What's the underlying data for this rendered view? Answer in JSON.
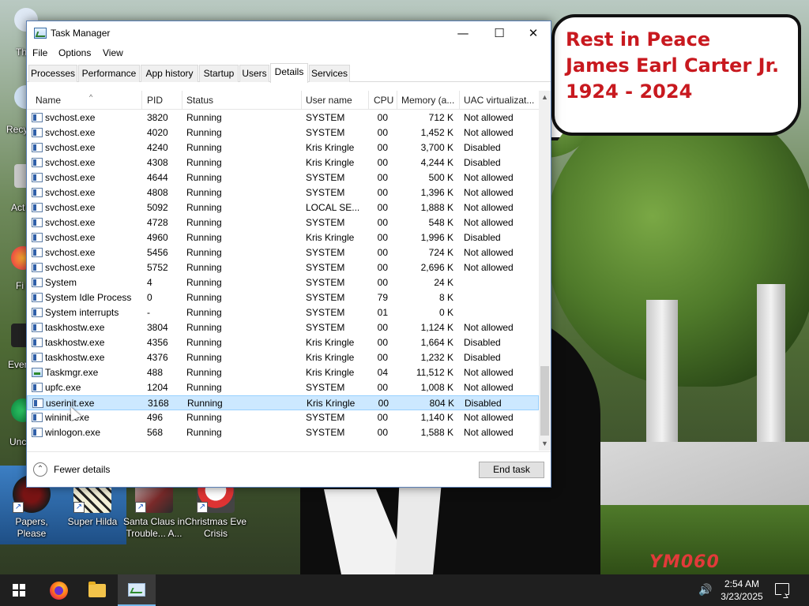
{
  "wallpaper": {
    "bubble_lines": [
      "Rest in Peace",
      "James Earl Carter Jr.",
      "1924 - 2024"
    ],
    "watermark": "YM060 ",
    "bubble_text_color": "#c8191f"
  },
  "desktop_icons": [
    {
      "name": "papers-please",
      "label": "Papers, Please",
      "icon": "game-icon"
    },
    {
      "name": "super-hilda",
      "label": "Super Hilda",
      "icon": "game-icon"
    },
    {
      "name": "santa-claus",
      "label": "Santa Claus in Trouble... A...",
      "icon": "game-icon"
    },
    {
      "name": "christmas-eve",
      "label": "Christmas Eve Crisis",
      "icon": "game-icon"
    }
  ],
  "partial_labels": {
    "th": "Th",
    "recy": "Recy",
    "act": "Act",
    "fi": "Fi",
    "ever": "Ever",
    "unc": "Unc"
  },
  "window": {
    "title": "Task Manager",
    "minimize": "—",
    "maximize": "☐",
    "close": "✕"
  },
  "menu": [
    "File",
    "Options",
    "View"
  ],
  "tabs": [
    "Processes",
    "Performance",
    "App history",
    "Startup",
    "Users",
    "Details",
    "Services"
  ],
  "active_tab": "Details",
  "columns": {
    "name": "Name",
    "pid": "PID",
    "status": "Status",
    "user": "User name",
    "cpu": "CPU",
    "memory": "Memory (a...",
    "uac": "UAC virtualizat..."
  },
  "sort_arrow": "^",
  "rows": [
    {
      "name": "svchost.exe",
      "pid": "3820",
      "status": "Running",
      "user": "SYSTEM",
      "cpu": "00",
      "mem": "712 K",
      "uac": "Not allowed"
    },
    {
      "name": "svchost.exe",
      "pid": "4020",
      "status": "Running",
      "user": "SYSTEM",
      "cpu": "00",
      "mem": "1,452 K",
      "uac": "Not allowed"
    },
    {
      "name": "svchost.exe",
      "pid": "4240",
      "status": "Running",
      "user": "Kris Kringle",
      "cpu": "00",
      "mem": "3,700 K",
      "uac": "Disabled"
    },
    {
      "name": "svchost.exe",
      "pid": "4308",
      "status": "Running",
      "user": "Kris Kringle",
      "cpu": "00",
      "mem": "4,244 K",
      "uac": "Disabled"
    },
    {
      "name": "svchost.exe",
      "pid": "4644",
      "status": "Running",
      "user": "SYSTEM",
      "cpu": "00",
      "mem": "500 K",
      "uac": "Not allowed"
    },
    {
      "name": "svchost.exe",
      "pid": "4808",
      "status": "Running",
      "user": "SYSTEM",
      "cpu": "00",
      "mem": "1,396 K",
      "uac": "Not allowed"
    },
    {
      "name": "svchost.exe",
      "pid": "5092",
      "status": "Running",
      "user": "LOCAL SE...",
      "cpu": "00",
      "mem": "1,888 K",
      "uac": "Not allowed"
    },
    {
      "name": "svchost.exe",
      "pid": "4728",
      "status": "Running",
      "user": "SYSTEM",
      "cpu": "00",
      "mem": "548 K",
      "uac": "Not allowed"
    },
    {
      "name": "svchost.exe",
      "pid": "4960",
      "status": "Running",
      "user": "Kris Kringle",
      "cpu": "00",
      "mem": "1,996 K",
      "uac": "Disabled"
    },
    {
      "name": "svchost.exe",
      "pid": "5456",
      "status": "Running",
      "user": "SYSTEM",
      "cpu": "00",
      "mem": "724 K",
      "uac": "Not allowed"
    },
    {
      "name": "svchost.exe",
      "pid": "5752",
      "status": "Running",
      "user": "SYSTEM",
      "cpu": "00",
      "mem": "2,696 K",
      "uac": "Not allowed"
    },
    {
      "name": "System",
      "pid": "4",
      "status": "Running",
      "user": "SYSTEM",
      "cpu": "00",
      "mem": "24 K",
      "uac": ""
    },
    {
      "name": "System Idle Process",
      "pid": "0",
      "status": "Running",
      "user": "SYSTEM",
      "cpu": "79",
      "mem": "8 K",
      "uac": ""
    },
    {
      "name": "System interrupts",
      "pid": "-",
      "status": "Running",
      "user": "SYSTEM",
      "cpu": "01",
      "mem": "0 K",
      "uac": ""
    },
    {
      "name": "taskhostw.exe",
      "pid": "3804",
      "status": "Running",
      "user": "SYSTEM",
      "cpu": "00",
      "mem": "1,124 K",
      "uac": "Not allowed"
    },
    {
      "name": "taskhostw.exe",
      "pid": "4356",
      "status": "Running",
      "user": "Kris Kringle",
      "cpu": "00",
      "mem": "1,664 K",
      "uac": "Disabled"
    },
    {
      "name": "taskhostw.exe",
      "pid": "4376",
      "status": "Running",
      "user": "Kris Kringle",
      "cpu": "00",
      "mem": "1,232 K",
      "uac": "Disabled"
    },
    {
      "name": "Taskmgr.exe",
      "pid": "488",
      "status": "Running",
      "user": "Kris Kringle",
      "cpu": "04",
      "mem": "11,512 K",
      "uac": "Not allowed"
    },
    {
      "name": "upfc.exe",
      "pid": "1204",
      "status": "Running",
      "user": "SYSTEM",
      "cpu": "00",
      "mem": "1,008 K",
      "uac": "Not allowed"
    },
    {
      "name": "userinit.exe",
      "pid": "3168",
      "status": "Running",
      "user": "Kris Kringle",
      "cpu": "00",
      "mem": "804 K",
      "uac": "Disabled"
    },
    {
      "name": "wininit.exe",
      "pid": "496",
      "status": "Running",
      "user": "SYSTEM",
      "cpu": "00",
      "mem": "1,140 K",
      "uac": "Not allowed"
    },
    {
      "name": "winlogon.exe",
      "pid": "568",
      "status": "Running",
      "user": "SYSTEM",
      "cpu": "00",
      "mem": "1,588 K",
      "uac": "Not allowed"
    }
  ],
  "selected_row_name": "userinit.exe",
  "footer": {
    "fewer_details": "Fewer details",
    "end_task": "End task"
  },
  "scrollbar": {
    "up": "▲",
    "down": "▼"
  },
  "taskbar": {
    "volume_icon": "🔊",
    "time": "2:54 AM",
    "date": "3/23/2025"
  }
}
